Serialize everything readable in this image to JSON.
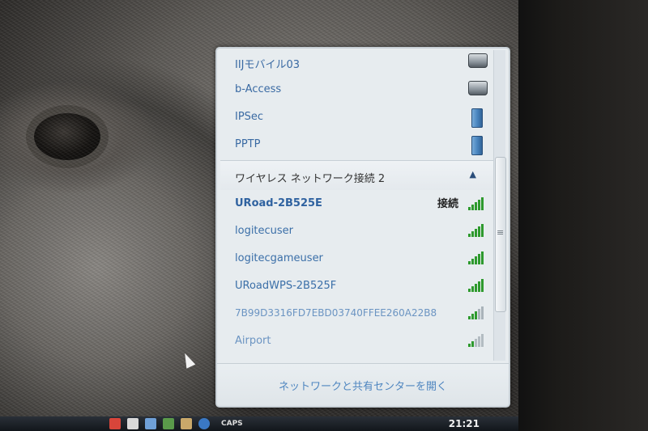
{
  "vpn_connections": [
    {
      "name": "IIJモバイル03",
      "icon": "modem-icon"
    },
    {
      "name": "b-Access",
      "icon": "modem-icon"
    },
    {
      "name": "IPSec",
      "icon": "server-icon"
    },
    {
      "name": "PPTP",
      "icon": "server-icon"
    }
  ],
  "wireless_section": {
    "title": "ワイヤレス ネットワーク接続 2",
    "collapse_icon": "chevron-up-icon"
  },
  "networks": [
    {
      "ssid": "URoad-2B525E",
      "status": "接続",
      "signal": "full"
    },
    {
      "ssid": "logitecuser",
      "status": "",
      "signal": "full"
    },
    {
      "ssid": "logitecgameuser",
      "status": "",
      "signal": "full"
    },
    {
      "ssid": "URoadWPS-2B525F",
      "status": "",
      "signal": "full"
    },
    {
      "ssid": "7B99D3316FD7EBD03740FFEE260A22B8",
      "status": "",
      "signal": "weak"
    },
    {
      "ssid": "Airport",
      "status": "",
      "signal": "weak"
    }
  ],
  "footer": {
    "link": "ネットワークと共有センターを開く"
  },
  "taskbar": {
    "caps_label": "CAPS",
    "clock": "21:21"
  },
  "colors": {
    "link_blue": "#3b6fa8",
    "signal_green": "#2e9a2e"
  }
}
